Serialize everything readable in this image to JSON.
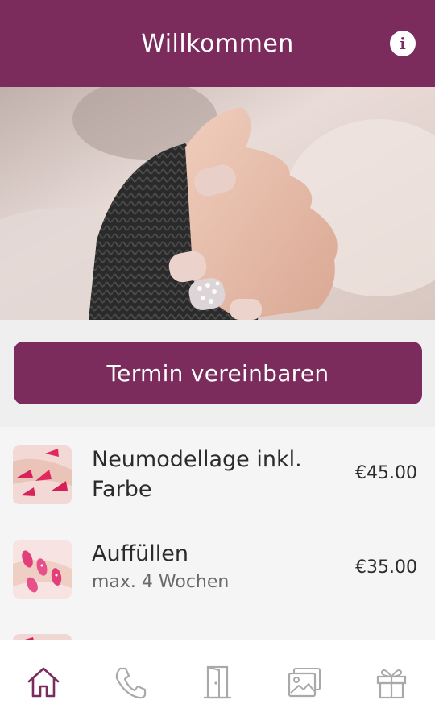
{
  "header": {
    "title": "Willkommen",
    "info_icon": "info-icon",
    "brand_color": "#7b2c5d"
  },
  "hero": {
    "image": "manicured-hand-in-black-knit-sleeve"
  },
  "cta": {
    "label": "Termin vereinbaren"
  },
  "services": [
    {
      "name": "Neumodellage inkl. Farbe",
      "subtitle": "",
      "price": "€45.00",
      "thumb": "pink-stiletto-nails-photo"
    },
    {
      "name": "Auffüllen",
      "subtitle": "max. 4 Wochen",
      "price": "€35.00",
      "thumb": "pink-nails-photo"
    }
  ],
  "nav": {
    "items": [
      {
        "icon": "home-icon",
        "active": true
      },
      {
        "icon": "phone-icon",
        "active": false
      },
      {
        "icon": "door-icon",
        "active": false
      },
      {
        "icon": "gallery-icon",
        "active": false
      },
      {
        "icon": "gift-icon",
        "active": false
      }
    ],
    "active_color": "#7b2c5d",
    "inactive_color": "#a9a9a9"
  }
}
